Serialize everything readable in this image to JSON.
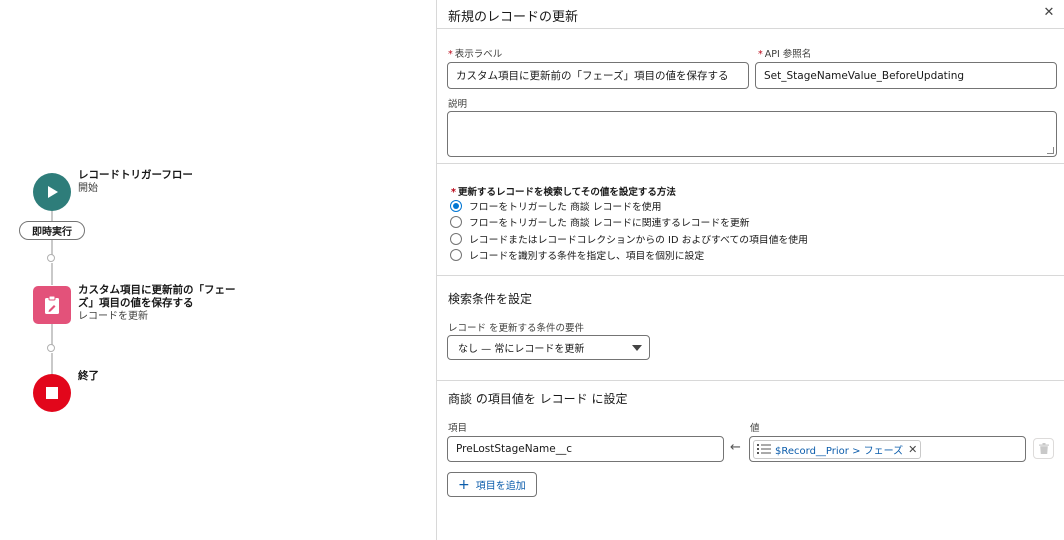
{
  "canvas": {
    "start_node": {
      "title": "レコードトリガーフロー",
      "subtitle": "開始"
    },
    "run_pill": "即時実行",
    "update_node": {
      "title_line1": "カスタム項目に更新前の「フェー",
      "title_line2": "ズ」項目の値を保存する",
      "subtitle": "レコードを更新"
    },
    "end_node": {
      "title": "終了"
    }
  },
  "panel": {
    "title": "新規のレコードの更新",
    "close_icon": "close-icon",
    "label_field": {
      "label": "表示ラベル",
      "value": "カスタム項目に更新前の「フェーズ」項目の値を保存する"
    },
    "api_field": {
      "label": "API 参照名",
      "value": "Set_StageNameValue_BeforeUpdating"
    },
    "description": {
      "label": "説明",
      "value": ""
    },
    "method": {
      "label": "更新するレコードを検索してその値を設定する方法",
      "options": [
        {
          "label": "フローをトリガーした 商談 レコードを使用",
          "checked": true
        },
        {
          "label": "フローをトリガーした 商談 レコードに関連するレコードを更新",
          "checked": false
        },
        {
          "label": "レコードまたはレコードコレクションからの ID およびすべての項目値を使用",
          "checked": false
        },
        {
          "label": "レコードを識別する条件を指定し、項目を個別に設定",
          "checked": false
        }
      ]
    },
    "criteria": {
      "heading": "検索条件を設定",
      "select_label": "レコード を更新する条件の要件",
      "select_value": "なし — 常にレコードを更新"
    },
    "assign": {
      "heading": "商談 の項目値を レコード に設定",
      "field_label": "項目",
      "value_label": "値",
      "field_value": "PreLostStageName__c",
      "value_token": "$Record__Prior > フェーズ",
      "add_button": "項目を追加"
    }
  },
  "colors": {
    "start": "#2e7d7a",
    "update": "#e3527a",
    "end": "#e2061b",
    "brand": "#0176d3",
    "link": "#0b5cab"
  }
}
